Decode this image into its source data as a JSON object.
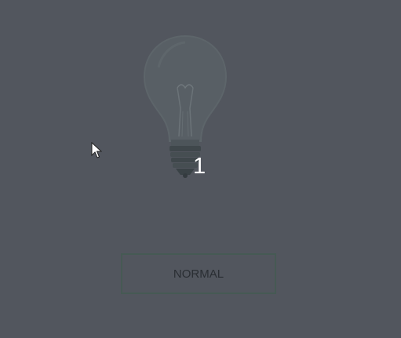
{
  "counter": {
    "value": "1"
  },
  "mode_button": {
    "label": "NORMAL"
  },
  "icons": {
    "bulb": "lightbulb-icon",
    "cursor": "mouse-pointer-icon"
  },
  "colors": {
    "background": "#52565e",
    "button_border": "#465a54",
    "counter_text": "#ffffff"
  }
}
